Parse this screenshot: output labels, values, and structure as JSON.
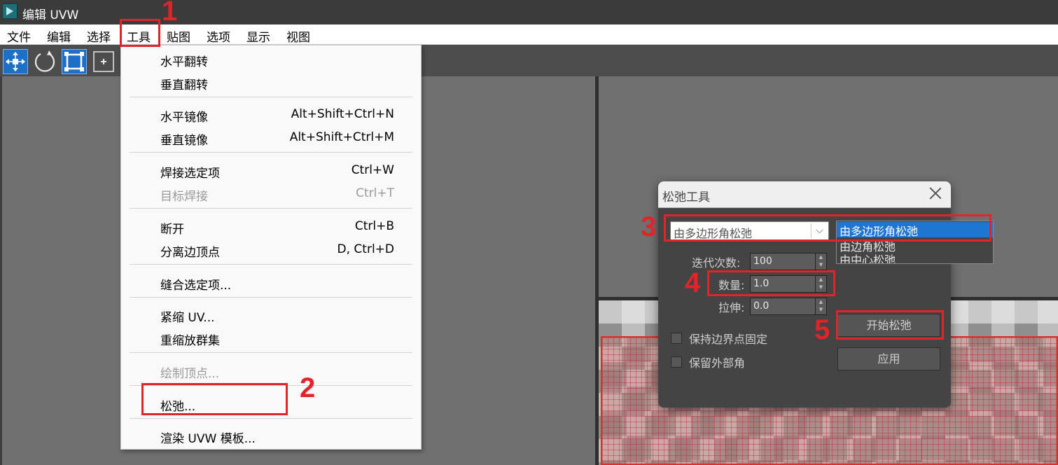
{
  "window": {
    "title": "编辑 UVW"
  },
  "menubar": {
    "items": [
      "文件",
      "编辑",
      "选择",
      "工具",
      "贴图",
      "选项",
      "显示",
      "视图"
    ]
  },
  "toolbar": {
    "icons": [
      "move-icon",
      "rotate-icon",
      "scale-icon",
      "freeform-icon"
    ]
  },
  "tools_menu": {
    "items": [
      {
        "label": "水平翻转",
        "shortcut": "",
        "enabled": true
      },
      {
        "label": "垂直翻转",
        "shortcut": "",
        "enabled": true
      },
      {
        "label": "水平镜像",
        "shortcut": "Alt+Shift+Ctrl+N",
        "enabled": true
      },
      {
        "label": "垂直镜像",
        "shortcut": "Alt+Shift+Ctrl+M",
        "enabled": true
      },
      {
        "label": "焊接选定项",
        "shortcut": "Ctrl+W",
        "enabled": true
      },
      {
        "label": "目标焊接",
        "shortcut": "Ctrl+T",
        "enabled": false
      },
      {
        "label": "断开",
        "shortcut": "Ctrl+B",
        "enabled": true
      },
      {
        "label": "分离边顶点",
        "shortcut": "D, Ctrl+D",
        "enabled": true
      },
      {
        "label": "缝合选定项...",
        "shortcut": "",
        "enabled": true
      },
      {
        "label": "紧缩 UV...",
        "shortcut": "",
        "enabled": true
      },
      {
        "label": "重缩放群集",
        "shortcut": "",
        "enabled": true
      },
      {
        "label": "绘制顶点...",
        "shortcut": "",
        "enabled": false
      },
      {
        "label": "松弛...",
        "shortcut": "",
        "enabled": true
      },
      {
        "label": "渲染 UVW 模板...",
        "shortcut": "",
        "enabled": true
      }
    ]
  },
  "relax_dialog": {
    "title": "松弛工具",
    "method_value": "由多边形角松弛",
    "method_options": [
      "由多边形角松弛",
      "由边角松弛",
      "由中心松弛"
    ],
    "iterations_label": "迭代次数:",
    "iterations_value": "100",
    "amount_label": "数量:",
    "amount_value": "1.0",
    "stretch_label": "拉伸:",
    "stretch_value": "0.0",
    "keep_boundary_label": "保持边界点固定",
    "keep_boundary_checked": false,
    "save_outer_label": "保留外部角",
    "save_outer_checked": false,
    "start_button": "开始松弛",
    "apply_button": "应用"
  },
  "annotations": {
    "steps": [
      "1",
      "2",
      "3",
      "4",
      "5"
    ],
    "color": "#e0242a"
  },
  "colors": {
    "selection_blue": "#1f76d2",
    "dialog_bg": "#444444",
    "uv_edges": "#d93030"
  }
}
